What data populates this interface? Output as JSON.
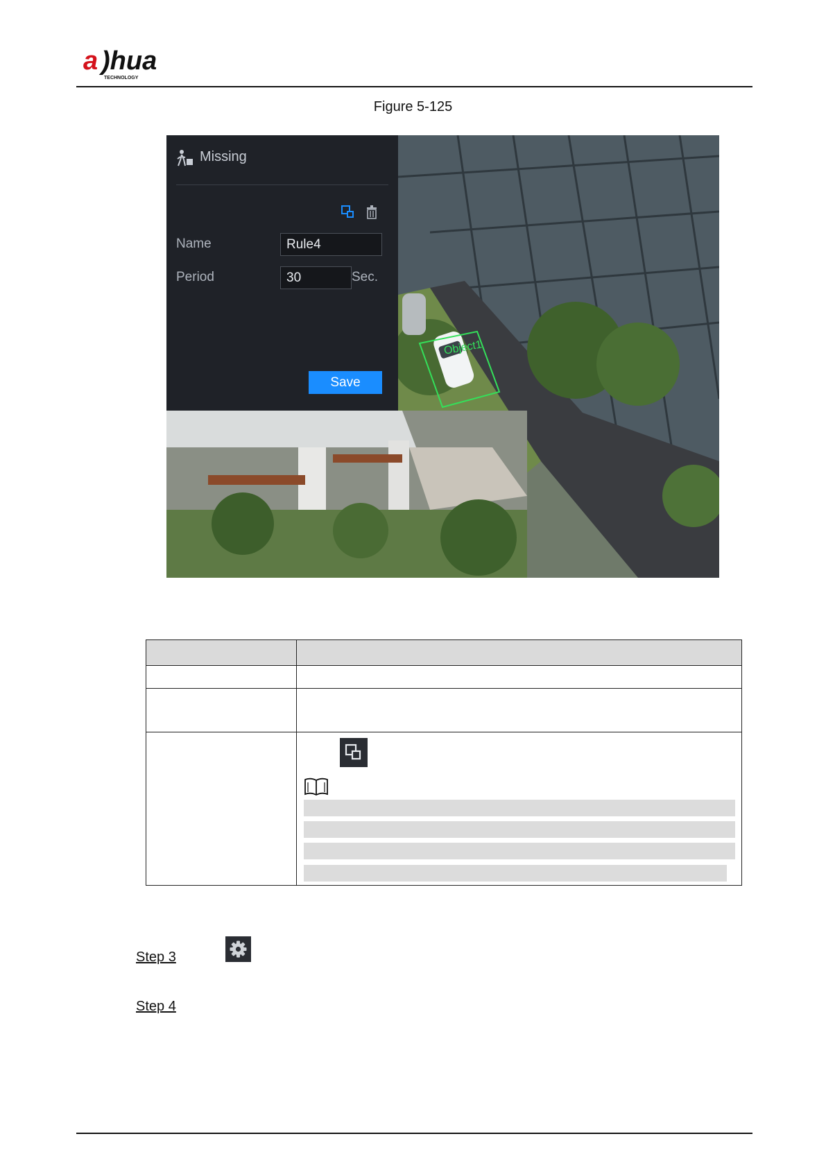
{
  "header": {
    "brand_text": "alhua",
    "brand_subtext": "TECHNOLOGY"
  },
  "figure": {
    "caption": "Figure 5-125",
    "panel": {
      "title": "Missing",
      "name_label": "Name",
      "name_value": "Rule4",
      "period_label": "Period",
      "period_value": "30",
      "period_unit": "Sec.",
      "save_label": "Save"
    },
    "object_label": "Object1"
  },
  "table": {
    "header": [
      "",
      ""
    ]
  },
  "steps": {
    "step3_label": "Step 3",
    "step4_label": "Step 4"
  },
  "icons": {
    "draw": "draw-rule-icon",
    "delete": "trash-icon",
    "note": "book-icon",
    "settings": "gear-icon",
    "title": "missing-object-icon"
  },
  "colors": {
    "panel_bg": "#1f2228",
    "save_button": "#1a8dff",
    "object_box": "#34e05a"
  }
}
